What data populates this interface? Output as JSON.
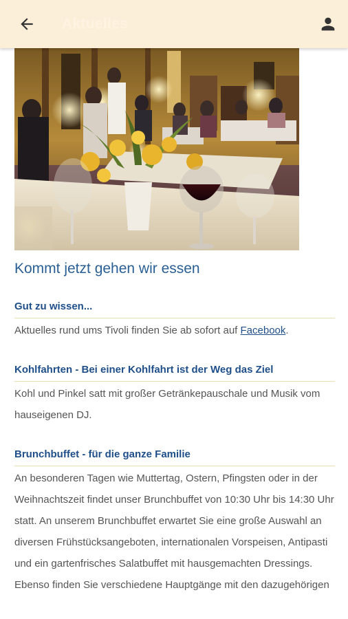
{
  "appbar": {
    "title": "Aktuelles",
    "back_icon": "arrow-left-icon",
    "profile_icon": "person-icon"
  },
  "article": {
    "headline": "Kommt jetzt gehen wir essen"
  },
  "sections": [
    {
      "title": "Gut zu wissen...",
      "text_before": "Aktuelles rund ums Tivoli finden Sie ab sofort auf ",
      "link": "Facebook",
      "text_after": "."
    },
    {
      "title": "Kohlfahrten - Bei einer Kohlfahrt ist der Weg das Ziel",
      "text": "Kohl und Pinkel satt mit großer Getränkepauschale und Musik vom hauseigenen DJ."
    },
    {
      "title": "Brunchbuffet - für die ganze Familie",
      "text": "An besonderen Tagen wie Muttertag, Ostern, Pfingsten oder in der Weihnachtszeit findet unser Brunchbuffet von 10:30 Uhr bis 14:30 Uhr statt. An unserem Brunchbuffet erwartet Sie eine große Auswahl an diversen Frühstücksangeboten, internationalen Vorspeisen, Antipasti und ein gartenfrisches Salatbuffet mit hausgemachten Dressings. Ebenso finden Sie verschiedene Hauptgänge mit den dazugehörigen"
    }
  ],
  "colors": {
    "appbar_bg": "#fcefd9",
    "accent": "#1f4f8a",
    "headline": "#2a5f95",
    "divider": "#ecdfb6"
  }
}
